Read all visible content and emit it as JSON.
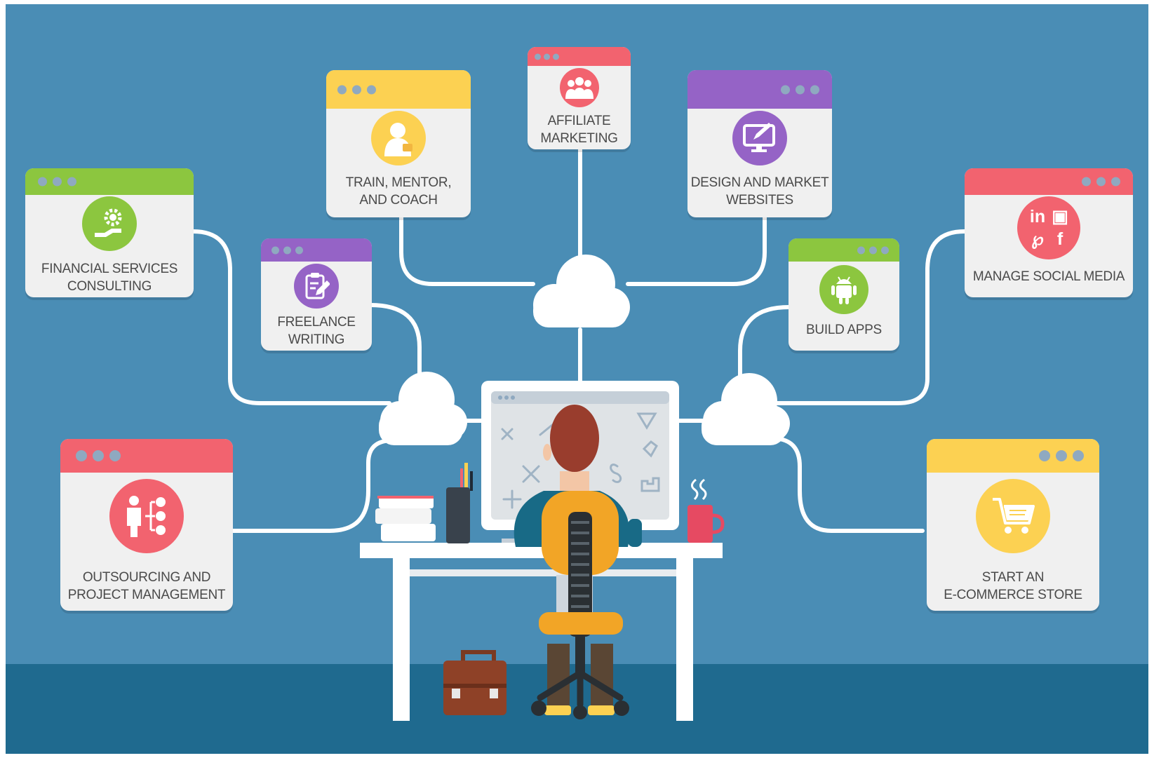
{
  "services": {
    "financial": {
      "label": "FINANCIAL SERVICES\nCONSULTING",
      "icon": "gear-hand-icon",
      "color": "#8cc63f"
    },
    "train": {
      "label": "TRAIN, MENTOR,\nAND COACH",
      "icon": "person-icon",
      "color": "#fcd152"
    },
    "affiliate": {
      "label": "AFFILIATE\nMARKETING",
      "icon": "group-icon",
      "color": "#f2636f"
    },
    "design": {
      "label": "DESIGN AND MARKET\nWEBSITES",
      "icon": "monitor-pen-icon",
      "color": "#9563c6"
    },
    "social": {
      "label": "MANAGE SOCIAL MEDIA",
      "icon": "social-media-icon",
      "color": "#f2636f",
      "glyphs": [
        "in",
        "▣",
        "℘",
        "f"
      ]
    },
    "freelance": {
      "label": "FREELANCE\nWRITING",
      "icon": "clipboard-pencil-icon",
      "color": "#9563c6"
    },
    "apps": {
      "label": "BUILD APPS",
      "icon": "android-icon",
      "color": "#8cc63f"
    },
    "outsourcing": {
      "label": "OUTSOURCING AND\nPROJECT MANAGEMENT",
      "icon": "org-chart-icon",
      "color": "#f2636f"
    },
    "ecommerce": {
      "label": "START AN\nE-COMMERCE STORE",
      "icon": "shopping-cart-icon",
      "color": "#fcd152"
    }
  },
  "colors": {
    "background": "#4a8db5",
    "floor": "#1f6a8f",
    "card": "#f0f0f0",
    "connector": "#ffffff",
    "green": "#8cc63f",
    "yellow": "#fcd152",
    "red": "#f2636f",
    "purple": "#9563c6"
  }
}
